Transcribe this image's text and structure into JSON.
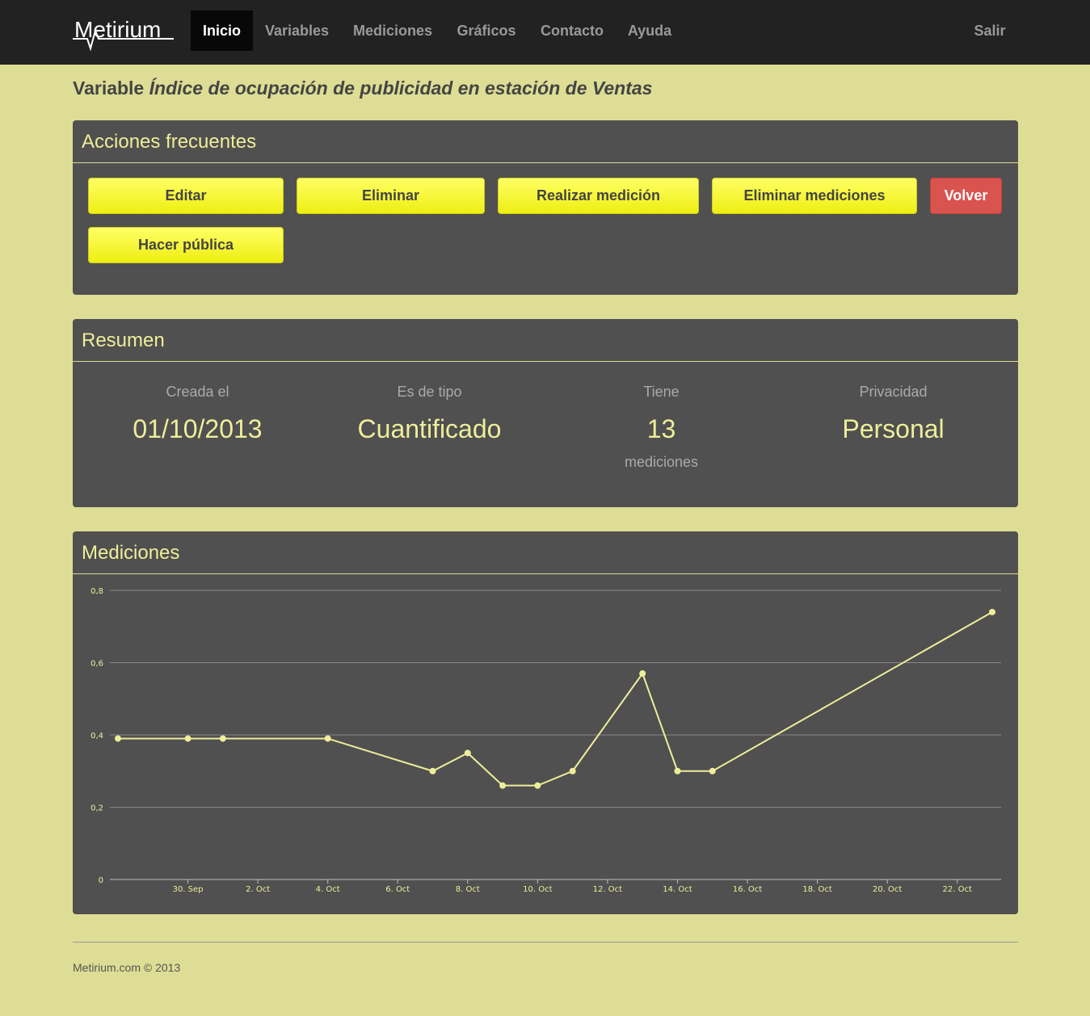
{
  "nav": {
    "brand": "Metirium",
    "items": [
      "Inicio",
      "Variables",
      "Mediciones",
      "Gráficos",
      "Contacto",
      "Ayuda"
    ],
    "logout": "Salir"
  },
  "title": {
    "prefix": "Variable",
    "name": "Índice de ocupación de publicidad en estación de Ventas"
  },
  "actions": {
    "heading": "Acciones frecuentes",
    "edit": "Editar",
    "delete": "Eliminar",
    "measure": "Realizar medición",
    "delete_measurements": "Eliminar mediciones",
    "back": "Volver",
    "make_public": "Hacer pública"
  },
  "summary": {
    "heading": "Resumen",
    "created_label": "Creada el",
    "created_value": "01/10/2013",
    "type_label": "Es de tipo",
    "type_value": "Cuantificado",
    "count_label": "Tiene",
    "count_value": "13",
    "count_unit": "mediciones",
    "privacy_label": "Privacidad",
    "privacy_value": "Personal"
  },
  "measurements": {
    "heading": "Mediciones"
  },
  "chart_data": {
    "type": "line",
    "x": [
      "2013-09-28",
      "2013-09-30",
      "2013-10-01",
      "2013-10-04",
      "2013-10-07",
      "2013-10-08",
      "2013-10-09",
      "2013-10-10",
      "2013-10-11",
      "2013-10-13",
      "2013-10-14",
      "2013-10-15",
      "2013-10-23"
    ],
    "y": [
      0.39,
      0.39,
      0.39,
      0.39,
      0.3,
      0.35,
      0.26,
      0.26,
      0.3,
      0.57,
      0.3,
      0.3,
      0.74
    ],
    "ylim": [
      0,
      0.8
    ],
    "yticks": [
      "0",
      "0,2",
      "0,4",
      "0,6",
      "0,8"
    ],
    "xticks": [
      "30. Sep",
      "2. Oct",
      "4. Oct",
      "6. Oct",
      "8. Oct",
      "10. Oct",
      "12. Oct",
      "14. Oct",
      "16. Oct",
      "18. Oct",
      "20. Oct",
      "22. Oct"
    ],
    "xtick_dates": [
      "2013-09-30",
      "2013-10-02",
      "2013-10-04",
      "2013-10-06",
      "2013-10-08",
      "2013-10-10",
      "2013-10-12",
      "2013-10-14",
      "2013-10-16",
      "2013-10-18",
      "2013-10-20",
      "2013-10-22"
    ],
    "xlim": [
      "2013-09-28",
      "2013-10-23"
    ],
    "grid": true,
    "line_color": "#eeee9a"
  },
  "footer": "Metirium.com © 2013"
}
